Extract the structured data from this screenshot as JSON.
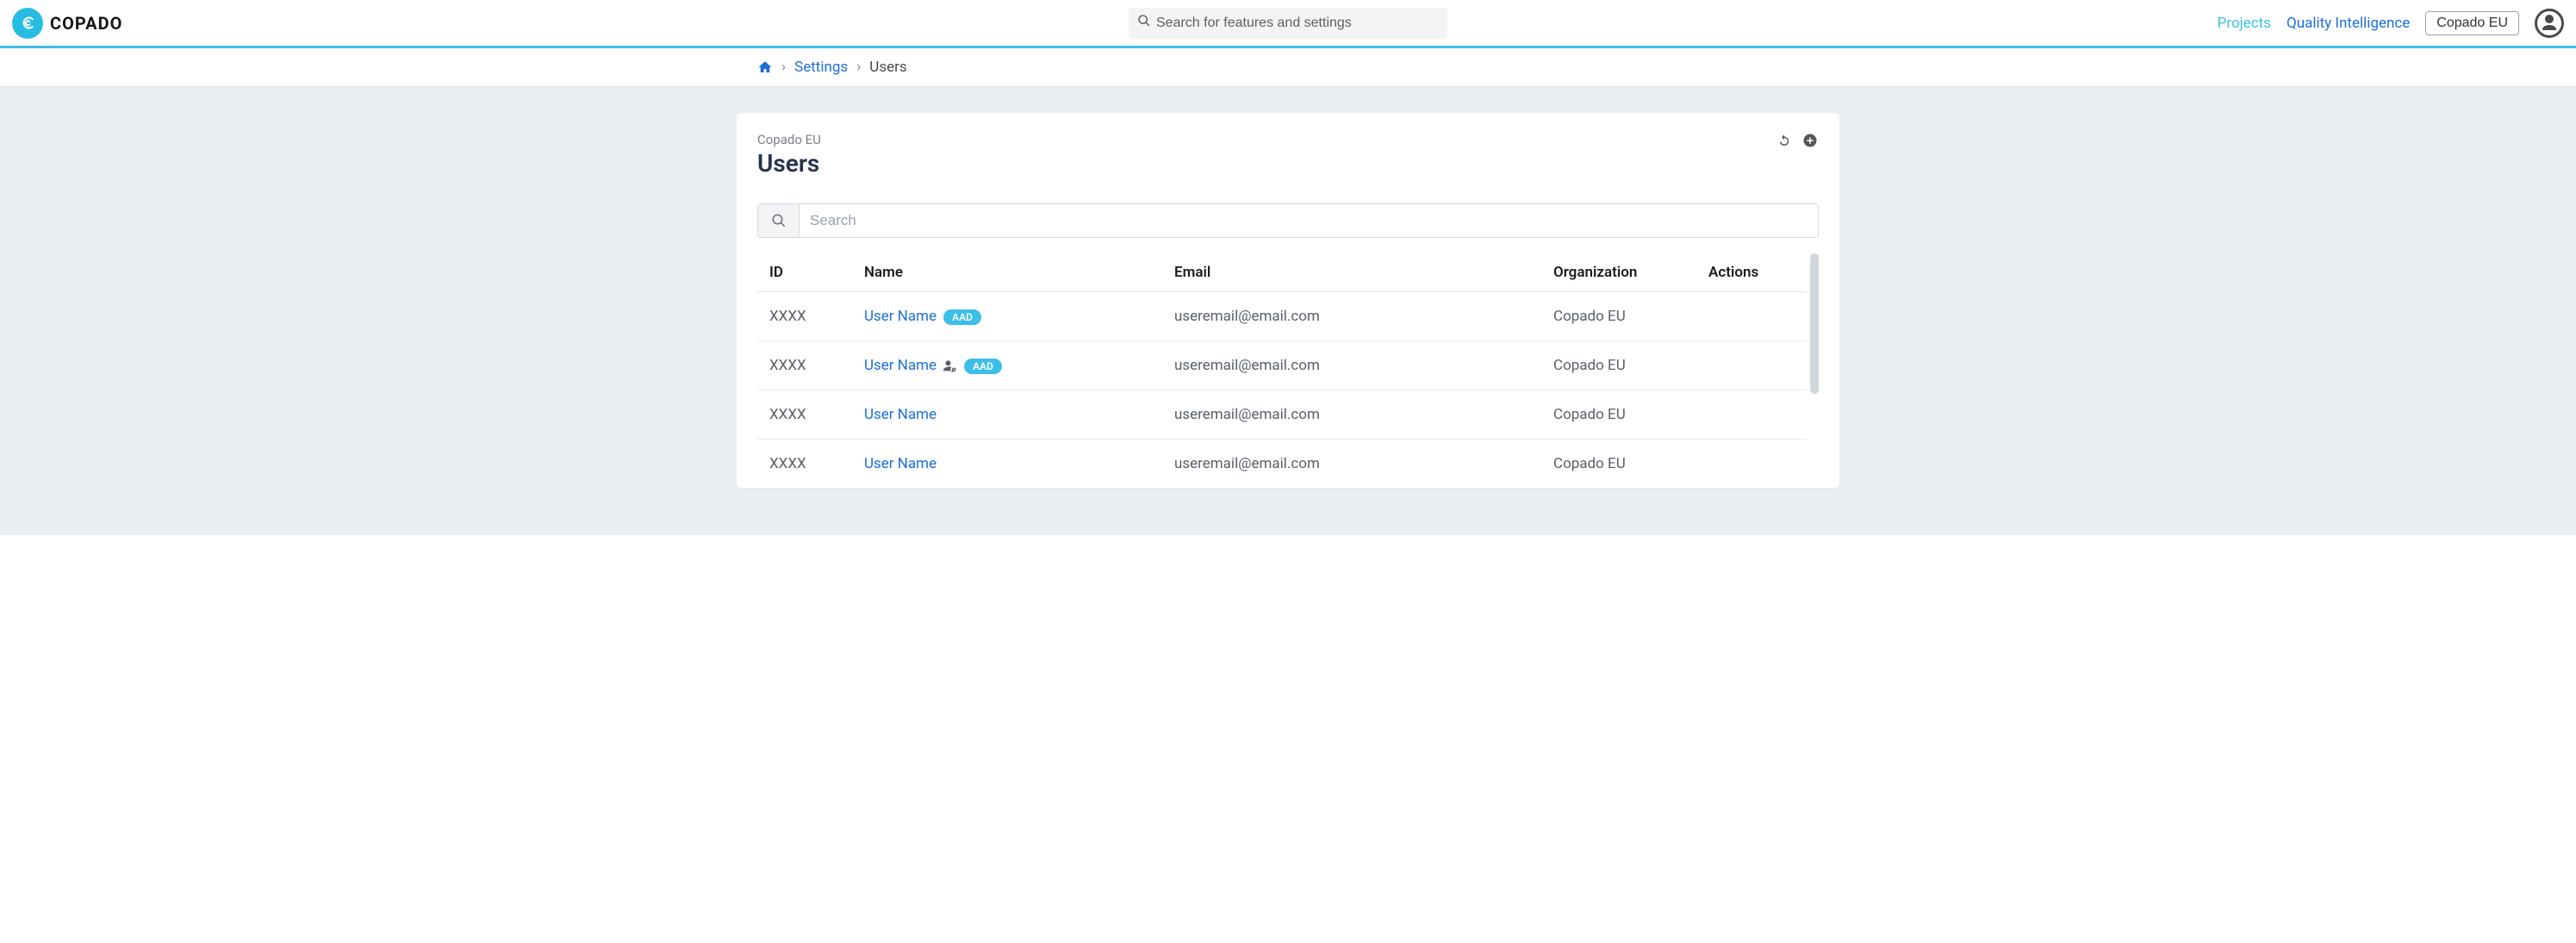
{
  "brand": {
    "name": "COPADO"
  },
  "header": {
    "search_placeholder": "Search for features and settings",
    "nav": {
      "projects": "Projects",
      "quality_intelligence": "Quality Intelligence"
    },
    "org_selector": "Copado EU"
  },
  "breadcrumb": {
    "settings": "Settings",
    "current": "Users"
  },
  "card": {
    "subtitle": "Copado EU",
    "title": "Users",
    "search_placeholder": "Search"
  },
  "table": {
    "columns": {
      "id": "ID",
      "name": "Name",
      "email": "Email",
      "organization": "Organization",
      "actions": "Actions"
    },
    "rows": [
      {
        "id": "XXXX",
        "name": "User Name",
        "badge": "AAD",
        "has_role_icon": false,
        "email": "useremail@email.com",
        "organization": "Copado EU"
      },
      {
        "id": "XXXX",
        "name": "User Name",
        "badge": "AAD",
        "has_role_icon": true,
        "email": "useremail@email.com",
        "organization": "Copado EU"
      },
      {
        "id": "XXXX",
        "name": "User Name",
        "badge": "",
        "has_role_icon": false,
        "email": "useremail@email.com",
        "organization": "Copado EU"
      },
      {
        "id": "XXXX",
        "name": "User Name",
        "badge": "",
        "has_role_icon": false,
        "email": "useremail@email.com",
        "organization": "Copado EU"
      }
    ]
  }
}
